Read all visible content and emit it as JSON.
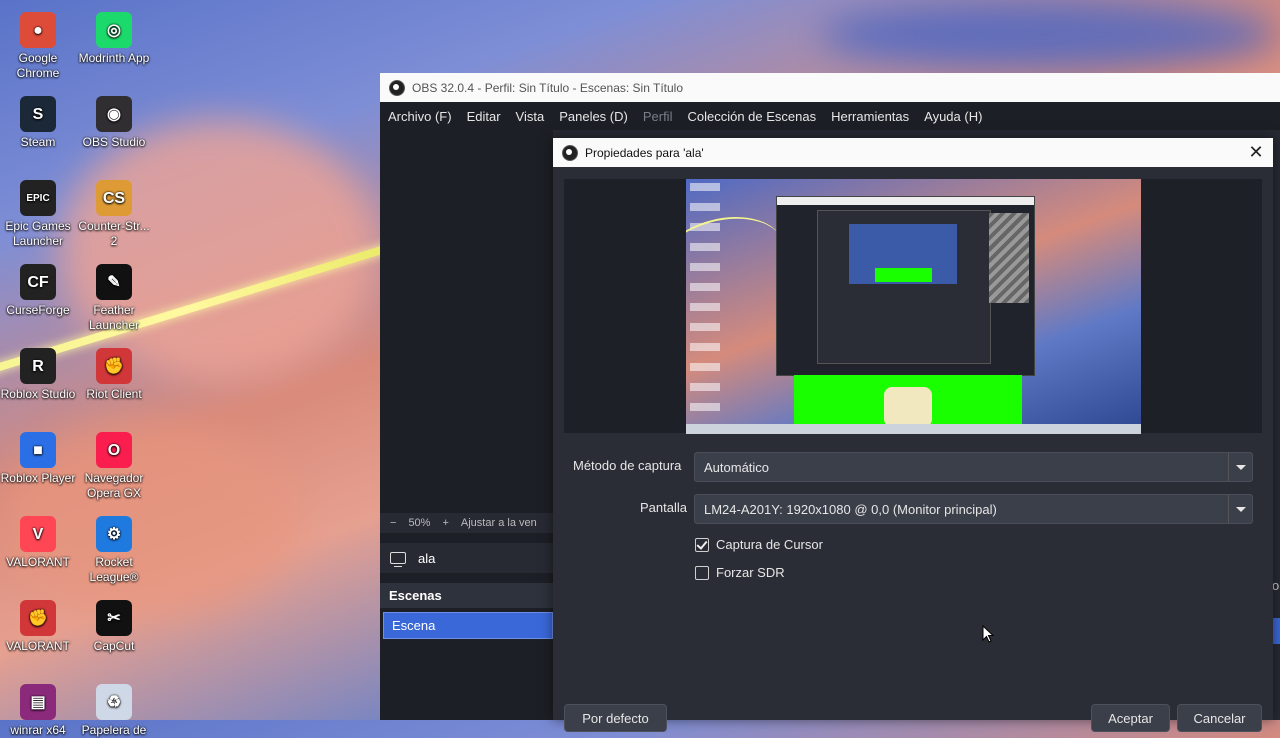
{
  "desktop": {
    "icons": [
      {
        "label": "Google Chrome",
        "icon": "chrome-icon",
        "color": "#dd4b39"
      },
      {
        "label": "Modrinth App",
        "icon": "modrinth-icon",
        "color": "#1bd96a"
      },
      {
        "label": "Steam",
        "icon": "steam-icon",
        "color": "#1b2838"
      },
      {
        "label": "OBS Studio",
        "icon": "obs-icon",
        "color": "#302e31"
      },
      {
        "label": "Epic Games Launcher",
        "icon": "epic-icon",
        "color": "#222222"
      },
      {
        "label": "Counter-Str... 2",
        "icon": "counter-strike-icon",
        "color": "#de9b35"
      },
      {
        "label": "CurseForge",
        "icon": "curseforge-icon",
        "color": "#222222"
      },
      {
        "label": "Feather Launcher",
        "icon": "feather-icon",
        "color": "#111111"
      },
      {
        "label": "Roblox Studio",
        "icon": "roblox-studio-icon",
        "color": "#222222"
      },
      {
        "label": "Riot Client",
        "icon": "riot-icon",
        "color": "#d13639"
      },
      {
        "label": "Roblox Player",
        "icon": "roblox-icon",
        "color": "#2b6fe6"
      },
      {
        "label": "Navegador Opera GX",
        "icon": "opera-gx-icon",
        "color": "#fa1e4e"
      },
      {
        "label": "VALORANT",
        "icon": "valorant-icon",
        "color": "#ff4655"
      },
      {
        "label": "Rocket League®",
        "icon": "rocket-league-icon",
        "color": "#1f7ae0"
      },
      {
        "label": "VALORANT",
        "icon": "valorant-riot-icon",
        "color": "#d13639"
      },
      {
        "label": "CapCut",
        "icon": "capcut-icon",
        "color": "#111111"
      },
      {
        "label": "winrar x64",
        "icon": "winrar-icon",
        "color": "#8b2a7a"
      },
      {
        "label": "Papelera de",
        "icon": "recycle-bin-icon",
        "color": "#cfd8e6"
      }
    ]
  },
  "obs": {
    "window_title": "OBS 32.0.4 - Perfil: Sin Título - Escenas: Sin Título",
    "menu": [
      "Archivo (F)",
      "Editar",
      "Vista",
      "Paneles (D)",
      "Perfil",
      "Colección de Escenas",
      "Herramientas",
      "Ayuda (H)"
    ],
    "zoom": {
      "minus": "−",
      "value": "50%",
      "plus": "+",
      "fit": "Ajustar a la ven"
    },
    "source_name": "ala",
    "scenes_header": "Escenas",
    "scene_item": "Escena",
    "right_edge_text": "o"
  },
  "dialog": {
    "title": "Propiedades para 'ala'",
    "close": "✕",
    "capture_method_label": "Método de captura",
    "capture_method_value": "Automático",
    "display_label": "Pantalla",
    "display_value": "LM24-A201Y: 1920x1080 @ 0,0 (Monitor principal)",
    "capture_cursor": {
      "label": "Captura de Cursor",
      "checked": true
    },
    "force_sdr": {
      "label": "Forzar SDR",
      "checked": false
    },
    "buttons": {
      "defaults": "Por defecto",
      "accept": "Aceptar",
      "cancel": "Cancelar"
    }
  },
  "colors": {
    "accent": "#3a68d8",
    "dialog_bg": "#2a2d36",
    "green_screen": "#19ff00"
  }
}
